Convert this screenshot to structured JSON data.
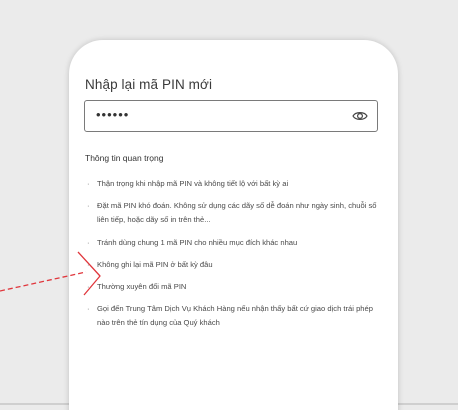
{
  "pin": {
    "label": "Nhập lại mã PIN mới",
    "value": "••••••"
  },
  "info": {
    "title": "Thông tin quan trọng",
    "items": [
      {
        "text": "Thận trọng khi nhập mã PIN và không tiết lộ với bất kỳ ai"
      },
      {
        "text": "Đặt mã PIN khó đoán. Không sử dụng các dãy số dễ đoán như ngày sinh, chuỗi số liên tiếp, hoặc dãy số in trên thẻ..."
      },
      {
        "text": "Tránh dùng chung 1 mã PIN cho nhiều mục đích khác nhau"
      },
      {
        "text": "Không ghi lại mã PIN ở bất kỳ đâu"
      },
      {
        "text": "Thường xuyên đổi mã PIN"
      },
      {
        "text": "Gọi đến Trung Tâm Dịch Vụ Khách Hàng nếu nhận thấy bất cứ giao dịch trái phép nào trên thẻ tín dụng của Quý khách"
      }
    ]
  },
  "icons": {
    "eye": "eye-icon"
  },
  "colors": {
    "annotation_arrow": "#e0363c",
    "background": "#ebebeb",
    "card": "#ffffff"
  }
}
